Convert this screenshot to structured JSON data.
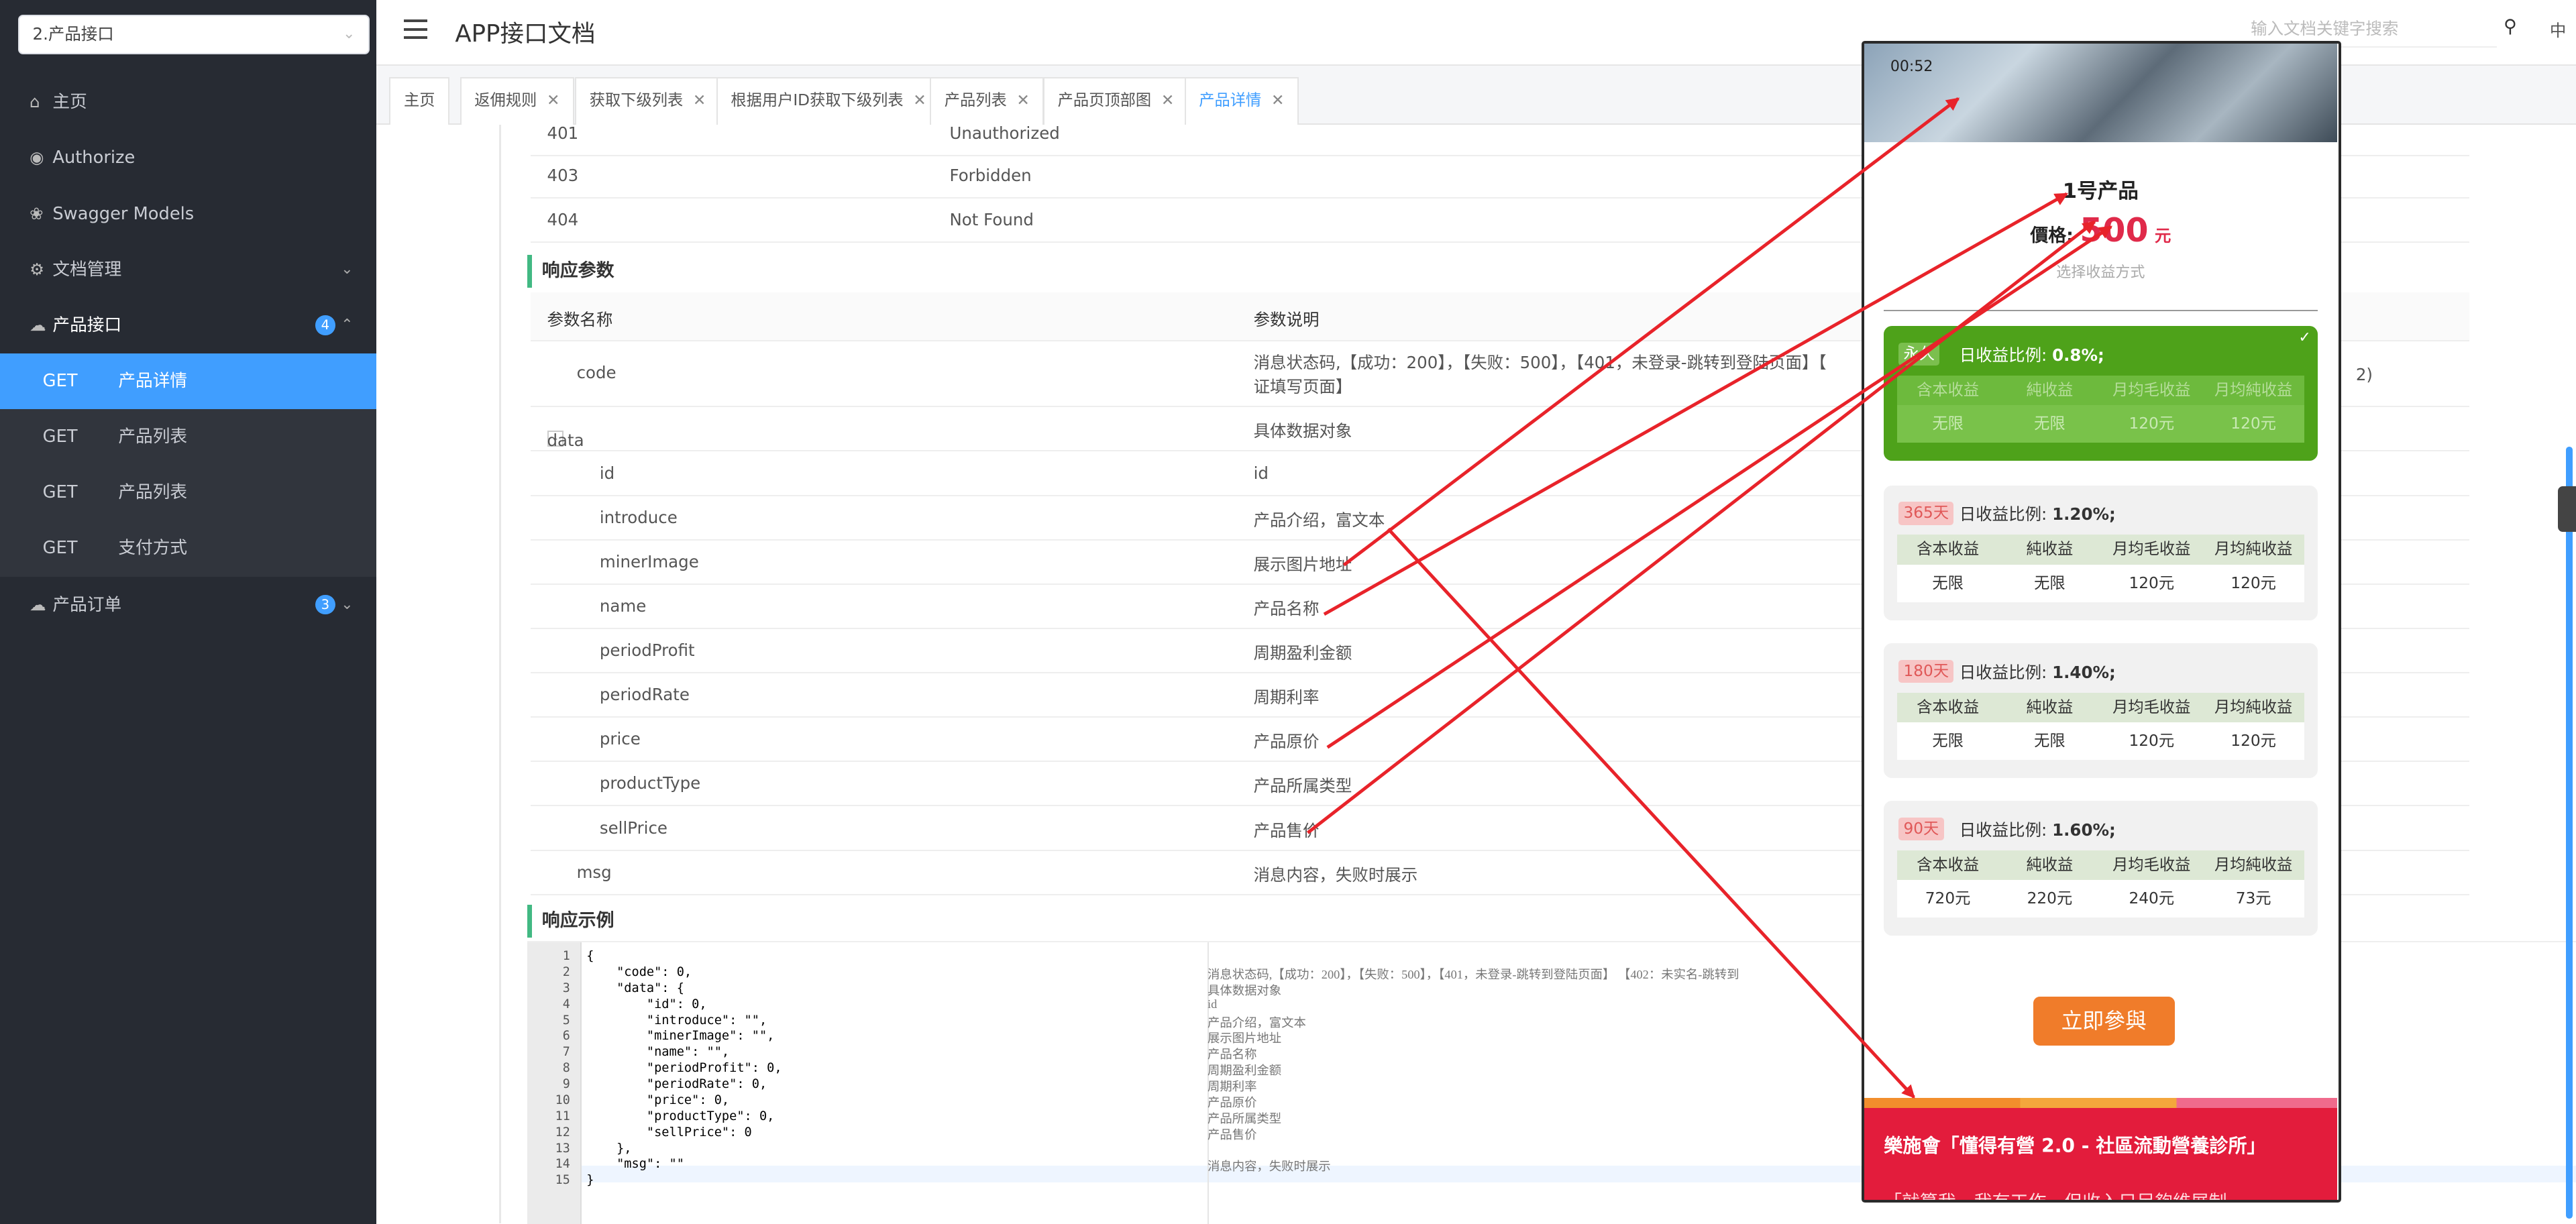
{
  "sidebar": {
    "select": "2.产品接口",
    "menu": [
      {
        "label": "主页",
        "icon": "home-icon"
      },
      {
        "label": "Authorize",
        "icon": "shield-icon"
      },
      {
        "label": "Swagger Models",
        "icon": "cube-icon"
      },
      {
        "label": "文档管理",
        "icon": "settings-icon"
      }
    ],
    "group1": {
      "label": "产品接口",
      "badge": "4"
    },
    "sub": [
      {
        "method": "GET",
        "label": "产品详情"
      },
      {
        "method": "GET",
        "label": "产品列表"
      },
      {
        "method": "GET",
        "label": "产品列表"
      },
      {
        "method": "GET",
        "label": "支付方式"
      }
    ],
    "group2": {
      "label": "产品订单",
      "badge": "3"
    }
  },
  "header": {
    "title": "APP接口文档",
    "search_placeholder": "输入文档关键字搜索",
    "lang": "中"
  },
  "tabs": [
    "主页",
    "返佣规则",
    "获取下级列表",
    "根据用户ID获取下级列表",
    "产品列表",
    "产品页顶部图",
    "产品详情"
  ],
  "status_rows": [
    {
      "code": "401",
      "desc": "Unauthorized"
    },
    {
      "code": "403",
      "desc": "Forbidden"
    },
    {
      "code": "404",
      "desc": "Not Found"
    }
  ],
  "resp": {
    "section": "响应参数",
    "col1": "参数名称",
    "col2": "参数说明",
    "rows": [
      {
        "name": "code",
        "desc": "消息状态码,【成功：200】，【失败：500】，【401，未登录-跳转到登陆页面】【",
        "desc2": "证填写页面】"
      },
      {
        "name": "data",
        "desc": "具体数据对象"
      },
      {
        "name": "id",
        "desc": "id"
      },
      {
        "name": "introduce",
        "desc": "产品介绍，富文本"
      },
      {
        "name": "minerImage",
        "desc": "展示图片地址"
      },
      {
        "name": "name",
        "desc": "产品名称"
      },
      {
        "name": "periodProfit",
        "desc": "周期盈利金额"
      },
      {
        "name": "periodRate",
        "desc": "周期利率"
      },
      {
        "name": "price",
        "desc": "产品原价"
      },
      {
        "name": "productType",
        "desc": "产品所属类型"
      },
      {
        "name": "sellPrice",
        "desc": "产品售价"
      },
      {
        "name": "msg",
        "desc": "消息内容，失败时展示"
      }
    ],
    "code_tail": "2)"
  },
  "example": {
    "section": "响应示例",
    "lines": [
      "{",
      "    \"code\": 0,",
      "    \"data\": {",
      "        \"id\": 0,",
      "        \"introduce\": \"\",",
      "        \"minerImage\": \"\",",
      "        \"name\": \"\",",
      "        \"periodProfit\": 0,",
      "        \"periodRate\": 0,",
      "        \"price\": 0,",
      "        \"productType\": 0,",
      "        \"sellPrice\": 0",
      "    },",
      "    \"msg\": \"\"",
      "}"
    ],
    "comments": [
      "消息状态码,【成功：200】，【失败：500】，【401，未登录-跳转到登陆页面】 【402：未实名-跳转到",
      "具体数据对象",
      "id",
      "产品介绍，富文本",
      "展示图片地址",
      "产品名称",
      "周期盈利金额",
      "周期利率",
      "产品原价",
      "产品所属类型",
      "产品售价",
      "",
      "消息内容，失败时展示"
    ]
  },
  "phone": {
    "time": "00:52",
    "title": "1号产品",
    "price_label": "價格:",
    "price": "500",
    "unit": "元",
    "sub": "选择收益方式",
    "cols": [
      "含本收益",
      "純收益",
      "月均毛收益",
      "月均純收益"
    ],
    "plans": [
      {
        "tag": "永久",
        "rate_label": "日收益比例:",
        "rate": "0.8%;",
        "vals": [
          "无限",
          "无限",
          "120元",
          "120元"
        ]
      },
      {
        "tag": "365天",
        "rate_label": "日收益比例:",
        "rate": "1.20%;",
        "vals": [
          "无限",
          "无限",
          "120元",
          "120元"
        ]
      },
      {
        "tag": "180天",
        "rate_label": "日收益比例:",
        "rate": "1.40%;",
        "vals": [
          "无限",
          "无限",
          "120元",
          "120元"
        ]
      },
      {
        "tag": "90天",
        "rate_label": "日收益比例:",
        "rate": "1.60%;",
        "vals": [
          "720元",
          "220元",
          "240元",
          "73元"
        ]
      }
    ],
    "button": "立即參與",
    "banner_title": "樂施會「懂得有營 2.0 - 社區流動營養診所」",
    "banner_sub": "「就算我一我有工作，但收入只足夠維展制"
  },
  "colors": {
    "accent": "#409eff",
    "sidebar": "#272b33",
    "arrow": "#e8232a",
    "plan_selected": "#4ea21a",
    "cta": "#f07c2a",
    "banner": "#e31c3c"
  }
}
